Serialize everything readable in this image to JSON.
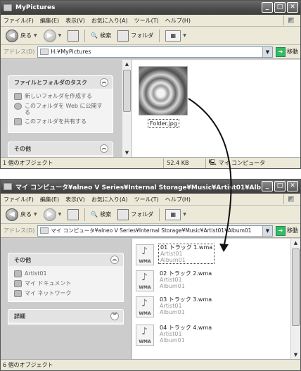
{
  "window1": {
    "title": "MyPictures",
    "menu": [
      "ファイル(F)",
      "編集(E)",
      "表示(V)",
      "お気に入り(A)",
      "ツール(T)",
      "ヘルプ(H)"
    ],
    "toolbar": {
      "back": "戻る",
      "search": "検索",
      "folders": "フォルダ"
    },
    "address": {
      "label": "アドレス(D)",
      "value": "H:¥MyPictures",
      "go": "移動"
    },
    "tasks_panel": {
      "title": "ファイルとフォルダのタスク",
      "items": [
        "新しいフォルダを作成する",
        "このフォルダを Web に公開する",
        "このフォルダを共有する"
      ]
    },
    "other_panel": {
      "title": "その他"
    },
    "file": {
      "name": "Folder.jpg"
    },
    "status": {
      "count": "1 個のオブジェクト",
      "size": "52.4 KB",
      "location": "マイ コンピュータ"
    }
  },
  "window2": {
    "title": "マイ コンピュータ¥alneo V Series¥Internal Storage¥Music¥Artist01¥Alb...",
    "menu": [
      "ファイル(F)",
      "編集(E)",
      "表示(V)",
      "お気に入り(A)",
      "ツール(T)",
      "ヘルプ(H)"
    ],
    "toolbar": {
      "back": "戻る",
      "search": "検索",
      "folders": "フォルダ"
    },
    "address": {
      "label": "アドレス(D)",
      "value": "マイ コンピュータ¥alneo V Series¥Internal Storage¥Music¥Artist01¥Album01",
      "go": "移動"
    },
    "other_panel": {
      "title": "その他",
      "items": [
        "Artist01",
        "マイ ドキュメント",
        "マイ ネットワーク"
      ]
    },
    "details_panel": {
      "title": "詳細"
    },
    "tracks": [
      {
        "name": "01 トラック 1.wma",
        "artist": "Artist01",
        "album": "Album01",
        "badge": "WMA"
      },
      {
        "name": "02 トラック 2.wma",
        "artist": "Artist01",
        "album": "Album01",
        "badge": "WMA"
      },
      {
        "name": "03 トラック 3.wma",
        "artist": "Artist01",
        "album": "Album01",
        "badge": "WMA"
      },
      {
        "name": "04 トラック 4.wma",
        "artist": "Artist01",
        "album": "Album01",
        "badge": "WMA"
      }
    ],
    "status": {
      "count": "6 個のオブジェクト"
    }
  },
  "colors": {
    "titlebar": "#4a4a4a",
    "taskpane": "#cccccc",
    "accent_go": "#33bb66"
  }
}
